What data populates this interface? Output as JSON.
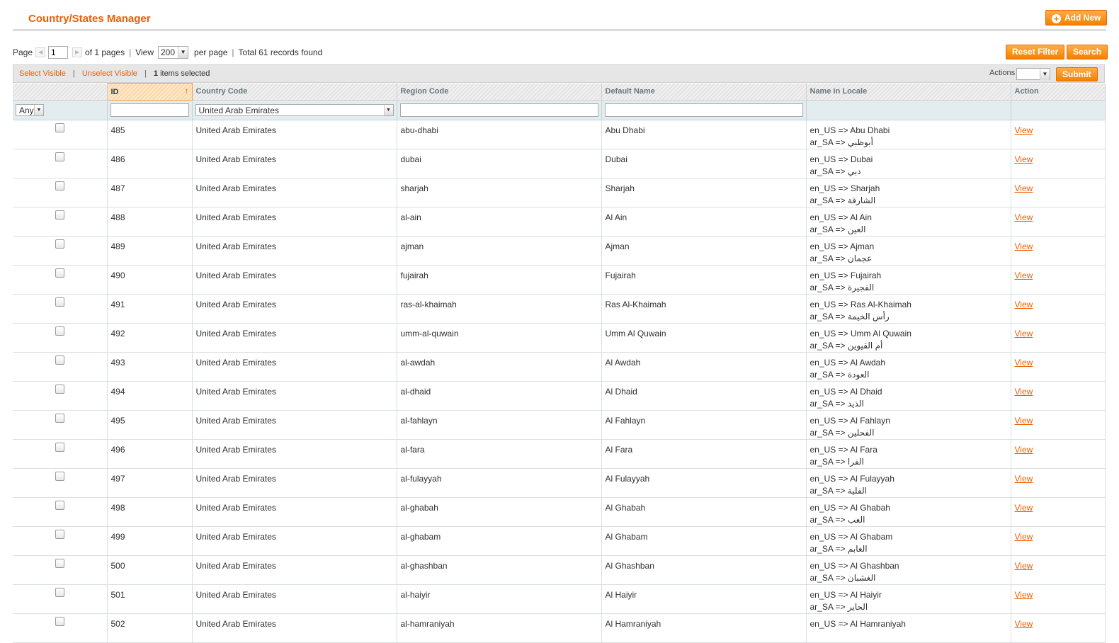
{
  "header": {
    "title": "Country/States Manager",
    "add_new_label": "Add New"
  },
  "pager": {
    "page_label": "Page",
    "page_value": "1",
    "of_pages": "of 1 pages",
    "view_label": "View",
    "view_value": "200",
    "per_page": "per page",
    "total": "Total 61 records found"
  },
  "buttons": {
    "reset_filter": "Reset Filter",
    "search": "Search",
    "submit": "Submit"
  },
  "massaction": {
    "select_visible": "Select Visible",
    "unselect_visible": "Unselect Visible",
    "count": "1",
    "items_selected": "items selected",
    "actions_label": "Actions"
  },
  "columns": [
    "",
    "ID",
    "Country Code",
    "Region Code",
    "Default Name",
    "Name in Locale",
    "Action"
  ],
  "filters": {
    "any": "Any",
    "country": "United Arab Emirates"
  },
  "rows": [
    {
      "id": "485",
      "country": "United Arab Emirates",
      "code": "abu-dhabi",
      "name": "Abu Dhabi",
      "en": "en_US => Abu Dhabi",
      "ar": "ar_SA => أبوظبي",
      "action": "View"
    },
    {
      "id": "486",
      "country": "United Arab Emirates",
      "code": "dubai",
      "name": "Dubai",
      "en": "en_US => Dubai",
      "ar": "ar_SA => دبي",
      "action": "View"
    },
    {
      "id": "487",
      "country": "United Arab Emirates",
      "code": "sharjah",
      "name": "Sharjah",
      "en": "en_US => Sharjah",
      "ar": "ar_SA => الشارقة",
      "action": "View"
    },
    {
      "id": "488",
      "country": "United Arab Emirates",
      "code": "al-ain",
      "name": "Al Ain",
      "en": "en_US => Al Ain",
      "ar": "ar_SA => العين",
      "action": "View"
    },
    {
      "id": "489",
      "country": "United Arab Emirates",
      "code": "ajman",
      "name": "Ajman",
      "en": "en_US => Ajman",
      "ar": "ar_SA => عجمان",
      "action": "View"
    },
    {
      "id": "490",
      "country": "United Arab Emirates",
      "code": "fujairah",
      "name": "Fujairah",
      "en": "en_US => Fujairah",
      "ar": "ar_SA => الفجيرة",
      "action": "View"
    },
    {
      "id": "491",
      "country": "United Arab Emirates",
      "code": "ras-al-khaimah",
      "name": "Ras Al-Khaimah",
      "en": "en_US => Ras Al-Khaimah",
      "ar": "ar_SA => رأس الخيمة",
      "action": "View"
    },
    {
      "id": "492",
      "country": "United Arab Emirates",
      "code": "umm-al-quwain",
      "name": "Umm Al Quwain",
      "en": "en_US => Umm Al Quwain",
      "ar": "ar_SA => أم القيوين",
      "action": "View"
    },
    {
      "id": "493",
      "country": "United Arab Emirates",
      "code": "al-awdah",
      "name": "Al Awdah",
      "en": "en_US => Al Awdah",
      "ar": "ar_SA => العودة",
      "action": "View"
    },
    {
      "id": "494",
      "country": "United Arab Emirates",
      "code": "al-dhaid",
      "name": "Al Dhaid",
      "en": "en_US => Al Dhaid",
      "ar": "ar_SA => الذيد",
      "action": "View"
    },
    {
      "id": "495",
      "country": "United Arab Emirates",
      "code": "al-fahlayn",
      "name": "Al Fahlayn",
      "en": "en_US => Al Fahlayn",
      "ar": "ar_SA => الفحلين",
      "action": "View"
    },
    {
      "id": "496",
      "country": "United Arab Emirates",
      "code": "al-fara",
      "name": "Al Fara",
      "en": "en_US => Al Fara",
      "ar": "ar_SA => الفرا",
      "action": "View"
    },
    {
      "id": "497",
      "country": "United Arab Emirates",
      "code": "al-fulayyah",
      "name": "Al Fulayyah",
      "en": "en_US => Al Fulayyah",
      "ar": "ar_SA => الفلية",
      "action": "View"
    },
    {
      "id": "498",
      "country": "United Arab Emirates",
      "code": "al-ghabah",
      "name": "Al Ghabah",
      "en": "en_US => Al Ghabah",
      "ar": "ar_SA => الغب",
      "action": "View"
    },
    {
      "id": "499",
      "country": "United Arab Emirates",
      "code": "al-ghabam",
      "name": "Al Ghabam",
      "en": "en_US => Al Ghabam",
      "ar": "ar_SA => الغابم",
      "action": "View"
    },
    {
      "id": "500",
      "country": "United Arab Emirates",
      "code": "al-ghashban",
      "name": "Al Ghashban",
      "en": "en_US => Al Ghashban",
      "ar": "ar_SA => الغشبان",
      "action": "View"
    },
    {
      "id": "501",
      "country": "United Arab Emirates",
      "code": "al-haiyir",
      "name": "Al Haiyir",
      "en": "en_US => Al Haiyir",
      "ar": "ar_SA => الحاير",
      "action": "View"
    },
    {
      "id": "502",
      "country": "United Arab Emirates",
      "code": "al-hamraniyah",
      "name": "Al Hamraniyah",
      "en": "en_US => Al Hamraniyah",
      "ar": "",
      "action": "View"
    }
  ]
}
